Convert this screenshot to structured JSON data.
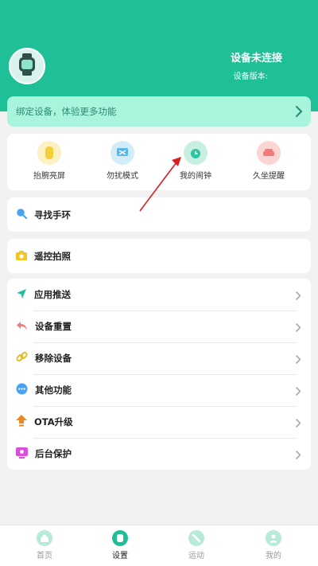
{
  "header": {
    "status": "设备未连接",
    "version_label": "设备版本:"
  },
  "bind_banner": {
    "text": "绑定设备，体验更多功能"
  },
  "quick_actions": [
    {
      "label": "抬腕亮屏",
      "icon": "wrist-raise-icon",
      "color": "#f4cf3a"
    },
    {
      "label": "勿扰模式",
      "icon": "do-not-disturb-icon",
      "color": "#56b7e8"
    },
    {
      "label": "我的闹钟",
      "icon": "alarm-clock-icon",
      "color": "#2ec5a0"
    },
    {
      "label": "久坐提醒",
      "icon": "sedentary-sofa-icon",
      "color": "#f07a7a"
    }
  ],
  "find_band": {
    "label": "寻找手环"
  },
  "remote_photo": {
    "label": "遥控拍照"
  },
  "settings_list": [
    {
      "label": "应用推送",
      "icon": "send-icon"
    },
    {
      "label": "设备重置",
      "icon": "reset-icon"
    },
    {
      "label": "移除设备",
      "icon": "link-icon"
    },
    {
      "label": "其他功能",
      "icon": "more-icon"
    },
    {
      "label": "OTA升级",
      "icon": "upgrade-icon"
    },
    {
      "label": "后台保护",
      "icon": "background-protect-icon"
    }
  ],
  "tabs": [
    {
      "label": "首页",
      "icon": "home-icon",
      "active": false
    },
    {
      "label": "设置",
      "icon": "watch-settings-icon",
      "active": true
    },
    {
      "label": "运动",
      "icon": "sport-icon",
      "active": false
    },
    {
      "label": "我的",
      "icon": "profile-icon",
      "active": false
    }
  ],
  "colors": {
    "header_bg": "#1fbf98",
    "banner_bg": "#a9f4dd",
    "accent": "#1fbf98",
    "annotation_arrow": "#d62020"
  }
}
